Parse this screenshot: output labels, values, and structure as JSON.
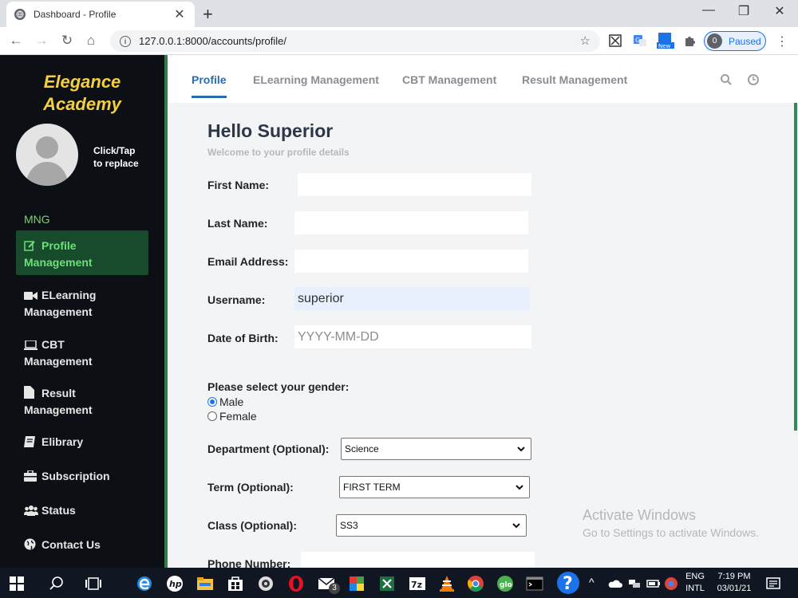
{
  "browser": {
    "tab_title": "Dashboard - Profile",
    "url": "127.0.0.1:8000/accounts/profile/",
    "profile_initial": "0",
    "profile_status": "Paused"
  },
  "sidebar": {
    "brand_line1": "Elegance",
    "brand_line2": "Academy",
    "replace_line1": "Click/Tap",
    "replace_line2": "to replace",
    "section_label": "MNG",
    "items": [
      {
        "line1": "Profile",
        "line2": "Management",
        "icon": "edit-icon",
        "active": true
      },
      {
        "line1": "ELearning",
        "line2": "Management",
        "icon": "video-icon"
      },
      {
        "line1": "CBT",
        "line2": "Management",
        "icon": "laptop-icon"
      },
      {
        "line1": "Result",
        "line2": "Management",
        "icon": "file-icon"
      },
      {
        "line1": "Elibrary",
        "line2": "",
        "icon": "book-icon"
      },
      {
        "line1": "Subscription",
        "line2": "",
        "icon": "briefcase-icon"
      },
      {
        "line1": "Status",
        "line2": "",
        "icon": "users-icon"
      },
      {
        "line1": "Contact Us",
        "line2": "",
        "icon": "globe-icon"
      }
    ]
  },
  "topnav": {
    "tabs": [
      "Profile",
      "ELearning Management",
      "CBT Management",
      "Result Management"
    ],
    "active": "Profile"
  },
  "form": {
    "heading": "Hello Superior",
    "subheading": "Welcome to your profile details",
    "first_name_label": "First Name:",
    "first_name_value": "",
    "last_name_label": "Last Name:",
    "last_name_value": "",
    "email_label": "Email Address:",
    "email_value": "",
    "username_label": "Username:",
    "username_value": "superior",
    "dob_label": "Date of Birth:",
    "dob_placeholder": "YYYY-MM-DD",
    "gender_question": "Please select your gender:",
    "gender_options": [
      "Male",
      "Female"
    ],
    "gender_selected": "Male",
    "department_label": "Department (Optional):",
    "department_value": "Science",
    "term_label": "Term (Optional):",
    "term_value": "FIRST TERM",
    "class_label": "Class (Optional):",
    "class_value": "SS3",
    "phone_label": "Phone Number:"
  },
  "watermark": {
    "line1": "Activate Windows",
    "line2": "Go to Settings to activate Windows."
  },
  "taskbar": {
    "lang1": "ENG",
    "lang2": "INTL",
    "time": "7:19 PM",
    "date": "03/01/21",
    "badge_count": "3"
  },
  "colors": {
    "sidebar_bg": "#0c0f14",
    "brand_yellow": "#f4d03f",
    "accent_green": "#2e7d4a",
    "active_blue": "#2b6cb0"
  }
}
